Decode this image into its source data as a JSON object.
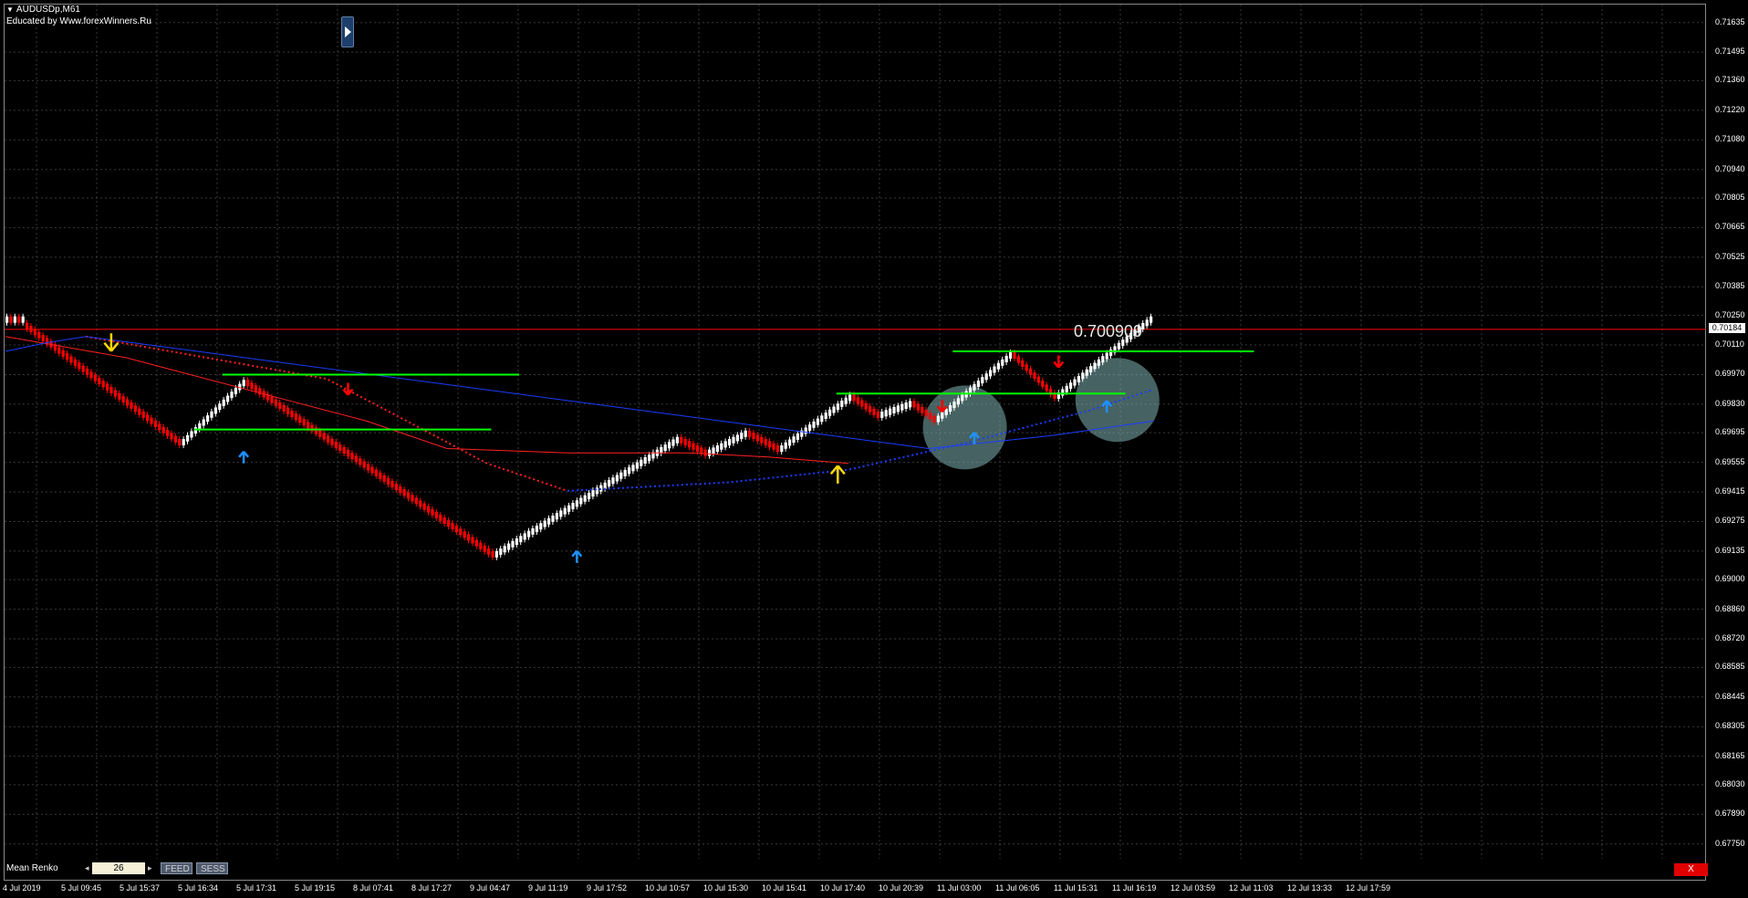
{
  "window": {
    "symbol": "AUDUSDp,M61",
    "educated_by": "Educated by Www.forexWinners.Ru"
  },
  "annotation": {
    "price_label": "0.700909"
  },
  "current_price": {
    "value": "0.70184",
    "line_price": 0.70184,
    "color": "#ff0000"
  },
  "colors": {
    "background": "#000000",
    "grid": "#3a3a3a",
    "bull_candle": "#ffffff",
    "bear_candle": "#ff0000",
    "level_line": "#00ff00",
    "ma_red": "#ff2020",
    "ma_blue": "#1a3cff",
    "arrow_blue": "#1e90ff",
    "arrow_yellow": "#ffd700",
    "highlight_circle": "#7fb3b3"
  },
  "bottom_panel": {
    "indicator_name": "Mean Renko",
    "period_value": "26",
    "feed_label": "FEED",
    "sess_label": "SESS",
    "close_label": "X",
    "left_arrow": "◂",
    "right_arrow": "▸"
  },
  "chart_data": {
    "type": "renko",
    "title": "AUDUSDp,M61",
    "ylim": [
      0.6768,
      0.7172
    ],
    "y_ticks": [
      "0.71635",
      "0.71495",
      "0.71360",
      "0.71220",
      "0.71080",
      "0.70940",
      "0.70805",
      "0.70665",
      "0.70525",
      "0.70385",
      "0.70250",
      "0.70110",
      "0.69970",
      "0.69830",
      "0.69695",
      "0.69555",
      "0.69415",
      "0.69275",
      "0.69135",
      "0.69000",
      "0.68860",
      "0.68720",
      "0.68585",
      "0.68445",
      "0.68305",
      "0.68165",
      "0.68030",
      "0.67890",
      "0.67750"
    ],
    "x_ticks": [
      "4 Jul 2019",
      "5 Jul 09:45",
      "5 Jul 15:37",
      "5 Jul 16:34",
      "5 Jul 17:31",
      "5 Jul 19:15",
      "8 Jul 07:41",
      "8 Jul 17:27",
      "9 Jul 04:47",
      "9 Jul 11:19",
      "9 Jul 17:52",
      "10 Jul 10:57",
      "10 Jul 15:30",
      "10 Jul 15:41",
      "10 Jul 17:40",
      "10 Jul 20:39",
      "11 Jul 03:00",
      "11 Jul 06:05",
      "11 Jul 15:31",
      "11 Jul 16:19",
      "12 Jul 03:59",
      "12 Jul 11:03",
      "12 Jul 13:33",
      "12 Jul 17:59"
    ],
    "bricks": [
      {
        "start": 0,
        "end": 5,
        "from": 0.7023,
        "to": 0.7023,
        "dir": "mixed"
      },
      {
        "start": 5,
        "end": 44,
        "from": 0.702,
        "to": 0.6965,
        "dir": "down"
      },
      {
        "start": 44,
        "end": 60,
        "from": 0.6965,
        "to": 0.6993,
        "dir": "up"
      },
      {
        "start": 60,
        "end": 122,
        "from": 0.6993,
        "to": 0.6912,
        "dir": "down"
      },
      {
        "start": 122,
        "end": 168,
        "from": 0.6912,
        "to": 0.6966,
        "dir": "up"
      },
      {
        "start": 168,
        "end": 175,
        "from": 0.6966,
        "to": 0.696,
        "dir": "down"
      },
      {
        "start": 175,
        "end": 185,
        "from": 0.696,
        "to": 0.6969,
        "dir": "up"
      },
      {
        "start": 185,
        "end": 193,
        "from": 0.6969,
        "to": 0.6962,
        "dir": "down"
      },
      {
        "start": 193,
        "end": 211,
        "from": 0.6962,
        "to": 0.6986,
        "dir": "up"
      },
      {
        "start": 211,
        "end": 218,
        "from": 0.6986,
        "to": 0.6978,
        "dir": "down"
      },
      {
        "start": 218,
        "end": 226,
        "from": 0.6978,
        "to": 0.6983,
        "dir": "up"
      },
      {
        "start": 226,
        "end": 232,
        "from": 0.6983,
        "to": 0.6976,
        "dir": "down"
      },
      {
        "start": 232,
        "end": 251,
        "from": 0.6976,
        "to": 0.7006,
        "dir": "up"
      },
      {
        "start": 251,
        "end": 262,
        "from": 0.7006,
        "to": 0.6987,
        "dir": "down"
      },
      {
        "start": 262,
        "end": 286,
        "from": 0.6987,
        "to": 0.7023,
        "dir": "up"
      }
    ],
    "ma_red_solid": [
      [
        0,
        0.7015
      ],
      [
        30,
        0.7005
      ],
      [
        60,
        0.699
      ],
      [
        90,
        0.6975
      ],
      [
        110,
        0.6962
      ],
      [
        140,
        0.696
      ],
      [
        170,
        0.696
      ],
      [
        190,
        0.6958
      ],
      [
        210,
        0.6955
      ]
    ],
    "ma_red_dotted": [
      [
        20,
        0.7015
      ],
      [
        50,
        0.7005
      ],
      [
        80,
        0.6995
      ],
      [
        100,
        0.6975
      ],
      [
        120,
        0.6955
      ],
      [
        140,
        0.6942
      ]
    ],
    "ma_blue_dotted": [
      [
        140,
        0.6942
      ],
      [
        180,
        0.6946
      ],
      [
        210,
        0.6952
      ],
      [
        240,
        0.6965
      ],
      [
        270,
        0.698
      ],
      [
        286,
        0.699
      ]
    ],
    "ma_blue_solid": [
      [
        0,
        0.7008
      ],
      [
        10,
        0.7012
      ],
      [
        20,
        0.7015
      ],
      [
        230,
        0.6962
      ],
      [
        260,
        0.6968
      ],
      [
        286,
        0.6975
      ]
    ],
    "levels": [
      {
        "price": 0.6997,
        "x_from": 54,
        "x_to": 128
      },
      {
        "price": 0.6971,
        "x_from": 47,
        "x_to": 121
      },
      {
        "price": 0.6988,
        "x_from": 207,
        "x_to": 279
      },
      {
        "price": 0.7008,
        "x_from": 236,
        "x_to": 311
      }
    ],
    "arrows": [
      {
        "i": 26,
        "price": 0.7012,
        "dir": "down",
        "color": "yellow"
      },
      {
        "i": 59,
        "price": 0.6958,
        "dir": "up",
        "color": "blue"
      },
      {
        "i": 85,
        "price": 0.699,
        "dir": "down",
        "color": "red"
      },
      {
        "i": 142,
        "price": 0.6911,
        "dir": "up",
        "color": "blue"
      },
      {
        "i": 207,
        "price": 0.695,
        "dir": "up",
        "color": "yellow"
      },
      {
        "i": 233,
        "price": 0.6982,
        "dir": "down",
        "color": "red"
      },
      {
        "i": 241,
        "price": 0.6967,
        "dir": "up",
        "color": "blue"
      },
      {
        "i": 262,
        "price": 0.7003,
        "dir": "down",
        "color": "red"
      },
      {
        "i": 274,
        "price": 0.6982,
        "dir": "up",
        "color": "blue"
      }
    ],
    "highlights": [
      {
        "i": 239,
        "price": 0.6972
      },
      {
        "i": 277,
        "price": 0.6985
      }
    ]
  }
}
